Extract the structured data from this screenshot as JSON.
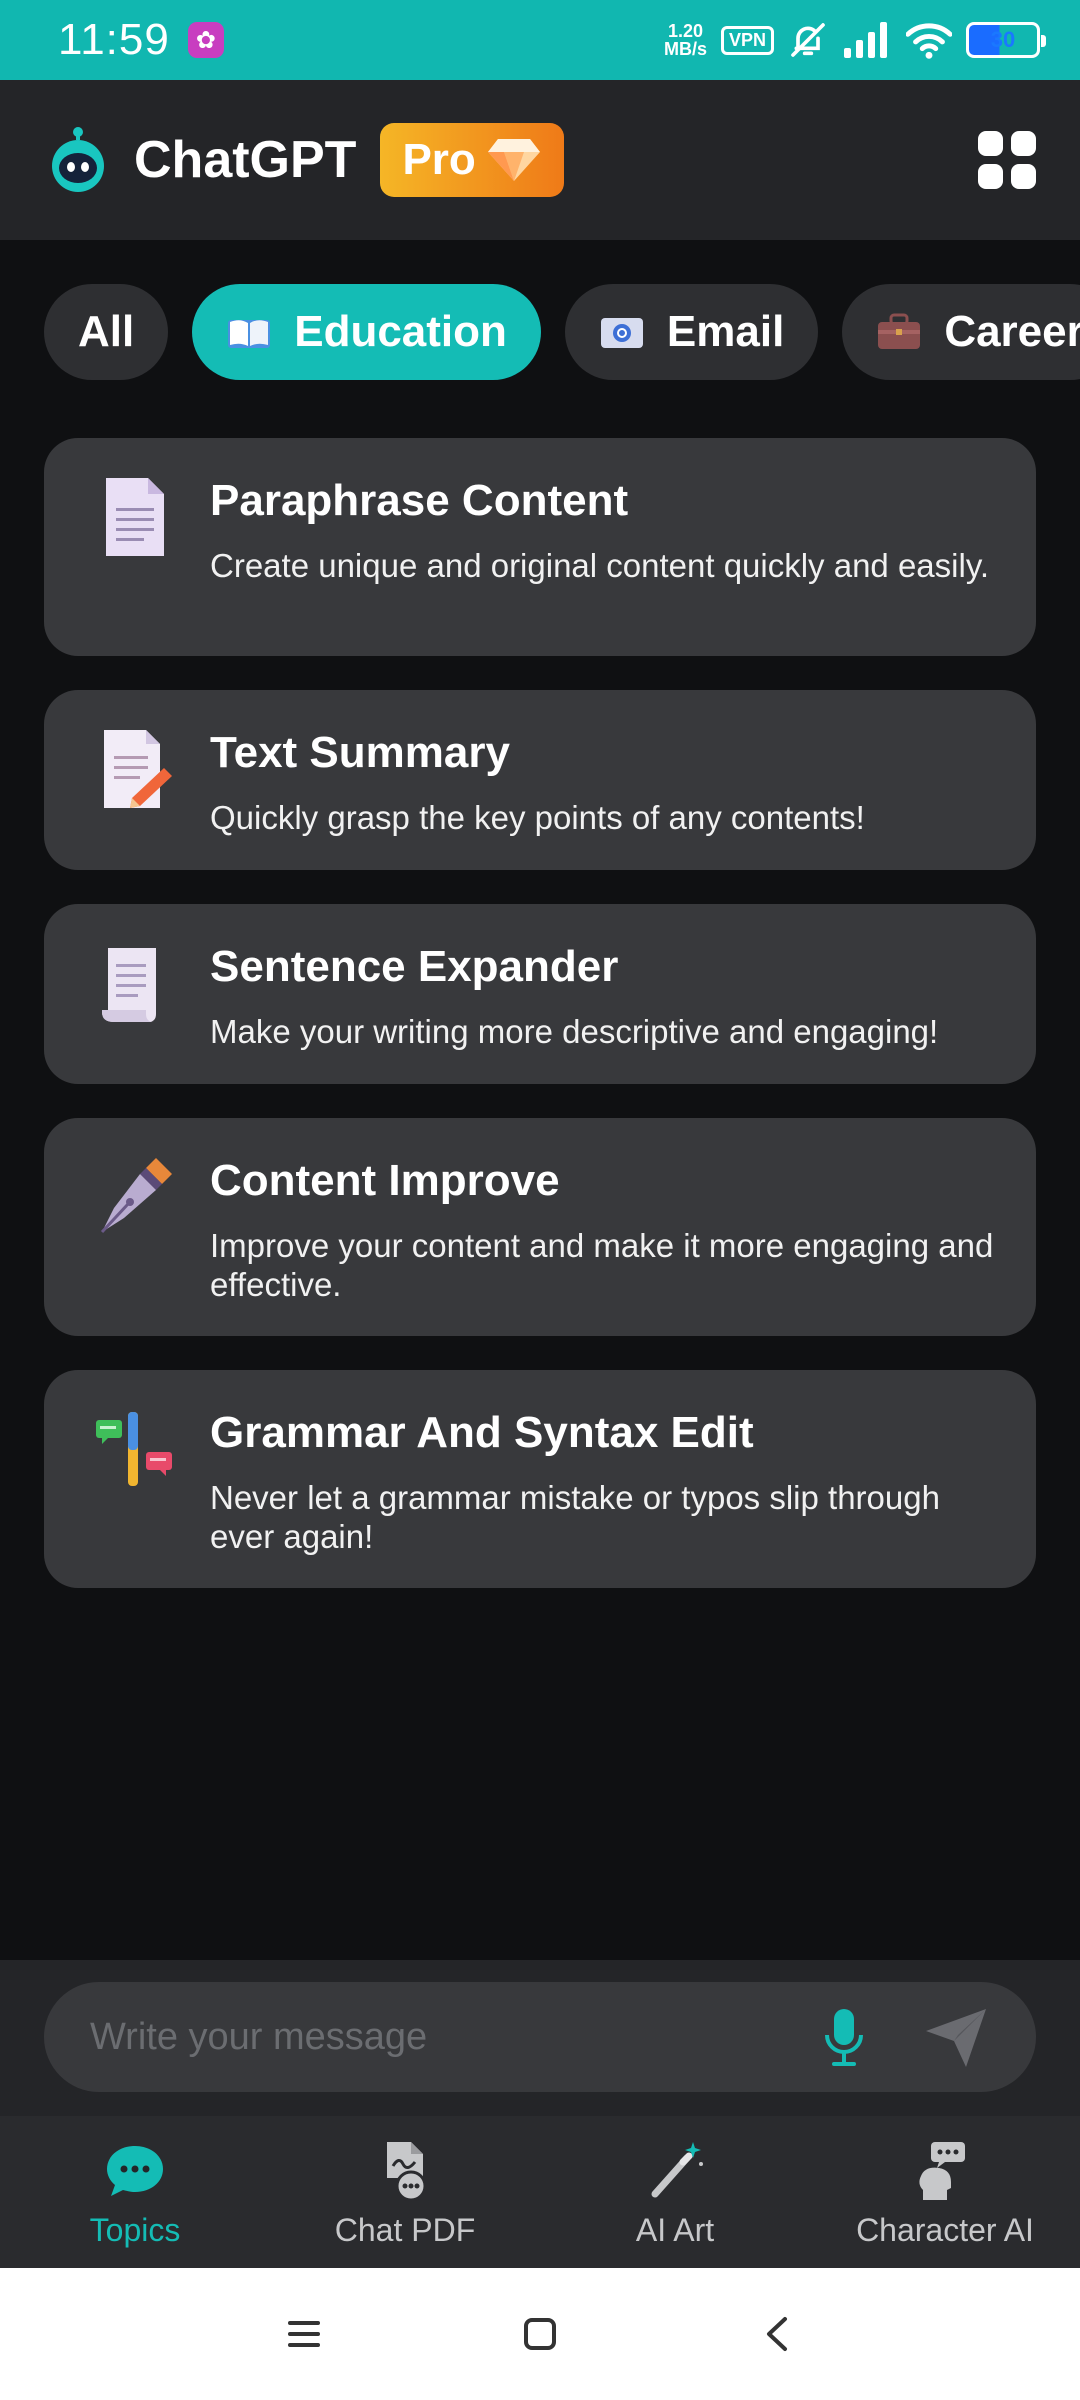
{
  "status_bar": {
    "time": "11:59",
    "net_speed_value": "1.20",
    "net_speed_unit": "MB/s",
    "vpn": "VPN",
    "battery": "30"
  },
  "header": {
    "title": "ChatGPT",
    "pro_label": "Pro"
  },
  "categories": [
    {
      "label": "All",
      "active": false
    },
    {
      "label": "Education",
      "active": true
    },
    {
      "label": "Email",
      "active": false
    },
    {
      "label": "Career",
      "active": false
    }
  ],
  "tools": [
    {
      "title": "Paraphrase Content",
      "description": "Create unique and original content quickly and easily."
    },
    {
      "title": "Text Summary",
      "description": "Quickly grasp the key points of any contents!"
    },
    {
      "title": "Sentence Expander",
      "description": "Make your writing more descriptive and engaging!"
    },
    {
      "title": "Content Improve",
      "description": "Improve your content and make it more engaging and effective."
    },
    {
      "title": "Grammar And Syntax Edit",
      "description": "Never let a grammar mistake or typos slip through ever again!"
    }
  ],
  "composer": {
    "placeholder": "Write your message"
  },
  "bottom_nav": [
    {
      "label": "Topics",
      "icon": "chat-bubble-icon",
      "active": true
    },
    {
      "label": "Chat PDF",
      "icon": "pdf-chat-icon",
      "active": false
    },
    {
      "label": "AI Art",
      "icon": "magic-wand-icon",
      "active": false
    },
    {
      "label": "Character AI",
      "icon": "character-icon",
      "active": false
    }
  ],
  "colors": {
    "accent": "#14bcb5",
    "status_bar": "#11b7b0",
    "background": "#0f1012",
    "card": "#38393c",
    "pro_gradient_start": "#f5b626",
    "pro_gradient_end": "#ef7a18"
  }
}
